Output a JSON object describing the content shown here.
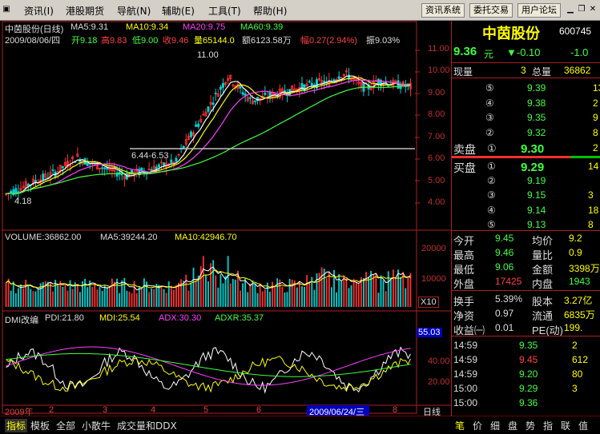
{
  "menu": {
    "items": [
      "资讯(I)",
      "港股期货",
      "导航(N)",
      "辅助(E)",
      "工具(T)",
      "帮助(H)"
    ],
    "buttons": [
      "资讯系统",
      "委托交易",
      "用户论坛"
    ]
  },
  "stock": {
    "header": "中茵股份(日线)",
    "ma5": "MA5:9.31",
    "ma10": "MA10:9.34",
    "ma20": "MA20:9.75",
    "ma60": "MA60:9.39",
    "date_line": "2009/08/06/四",
    "open": "开9.18",
    "high": "高9.83",
    "low": "低9.00",
    "close": "收9.46",
    "volume": "量65144.0",
    "amount": "额6123.58万",
    "change": "幅0.27(2.94%)",
    "amplitude": "振9.03%",
    "peak_label": "11.00",
    "range_label": "6.44-6.53",
    "low_label": "4.18"
  },
  "price_axis": [
    "11.00",
    "10.00",
    "9.00",
    "8.00",
    "7.00",
    "6.00",
    "5.00",
    "4.00"
  ],
  "volume_panel": {
    "label": "VOLUME:36862.00",
    "ma5": "MA5:39244.20",
    "ma10": "MA10:42946.70",
    "axis": [
      "20000",
      "10000"
    ],
    "unit": "X10"
  },
  "dmi_panel": {
    "label": "DMI改编",
    "pdi": "PDI:21.80",
    "mdi": "MDI:25.54",
    "adx": "ADX:30.30",
    "adxr": "ADXR:35.37",
    "axis": [
      "55.03",
      "40.00",
      "20.00"
    ]
  },
  "time_axis": {
    "start": "2009年",
    "labels": [
      "2",
      "3",
      "4",
      "5",
      "6",
      "7",
      "8"
    ],
    "cursor_date": "2009/06/24/三",
    "period": "日线"
  },
  "quote": {
    "name": "中茵股份",
    "code": "600745",
    "price": "9.36",
    "price_unit": "元",
    "change": "▼-0.10",
    "change_pct": "-1.0",
    "now_vol_label": "现量",
    "now_vol": "3",
    "total_vol_label": "总量",
    "total_vol": "36862",
    "sell_label": "卖盘",
    "buy_label": "买盘",
    "sells": [
      {
        "level": "⑤",
        "price": "9.39",
        "vol": "13"
      },
      {
        "level": "④",
        "price": "9.38",
        "vol": "2"
      },
      {
        "level": "③",
        "price": "9.35",
        "vol": "9"
      },
      {
        "level": "②",
        "price": "9.32",
        "vol": "8"
      },
      {
        "level": "①",
        "price": "9.30",
        "vol": "2"
      }
    ],
    "buys": [
      {
        "level": "①",
        "price": "9.29",
        "vol": "14"
      },
      {
        "level": "②",
        "price": "9.19",
        "vol": ""
      },
      {
        "level": "③",
        "price": "9.15",
        "vol": "3"
      },
      {
        "level": "④",
        "price": "9.14",
        "vol": "18"
      },
      {
        "level": "⑤",
        "price": "9.13",
        "vol": "8"
      }
    ],
    "stats": [
      {
        "l1": "今开",
        "v1": "9.45",
        "l2": "均价",
        "v2": "9.2"
      },
      {
        "l1": "最高",
        "v1": "9.46",
        "l2": "量比",
        "v2": "0.9"
      },
      {
        "l1": "最低",
        "v1": "9.06",
        "l2": "金额",
        "v2": "3398万"
      },
      {
        "l1": "外盘",
        "v1": "17425",
        "l2": "内盘",
        "v2": "1943"
      }
    ],
    "stats2": [
      {
        "l1": "换手",
        "v1": "5.39%",
        "l2": "股本",
        "v2": "3.27亿"
      },
      {
        "l1": "净资",
        "v1": "0.97",
        "l2": "流通",
        "v2": "6835万"
      },
      {
        "l1": "收益㈠",
        "v1": "0.01",
        "l2": "PE(动)",
        "v2": "199."
      }
    ],
    "ticks": [
      {
        "time": "14:59",
        "price": "9.35",
        "vol": "2"
      },
      {
        "time": "14:59",
        "price": "9.45",
        "vol": "612"
      },
      {
        "time": "14:59",
        "price": "9.20",
        "vol": "80"
      },
      {
        "time": "15:00",
        "price": "9.29",
        "vol": "3"
      },
      {
        "time": "15:00",
        "price": "9.36",
        "vol": ""
      }
    ]
  },
  "bottom_tabs": [
    "指标",
    "模板",
    "全部",
    "小散牛",
    "成交量和DDX"
  ],
  "right_tabs": [
    "笔",
    "价",
    "细",
    "盘",
    "势",
    "指",
    "联",
    "值"
  ],
  "colors": {
    "up": "#ff3030",
    "down": "#00d0d0",
    "accent": "#ffff00"
  }
}
